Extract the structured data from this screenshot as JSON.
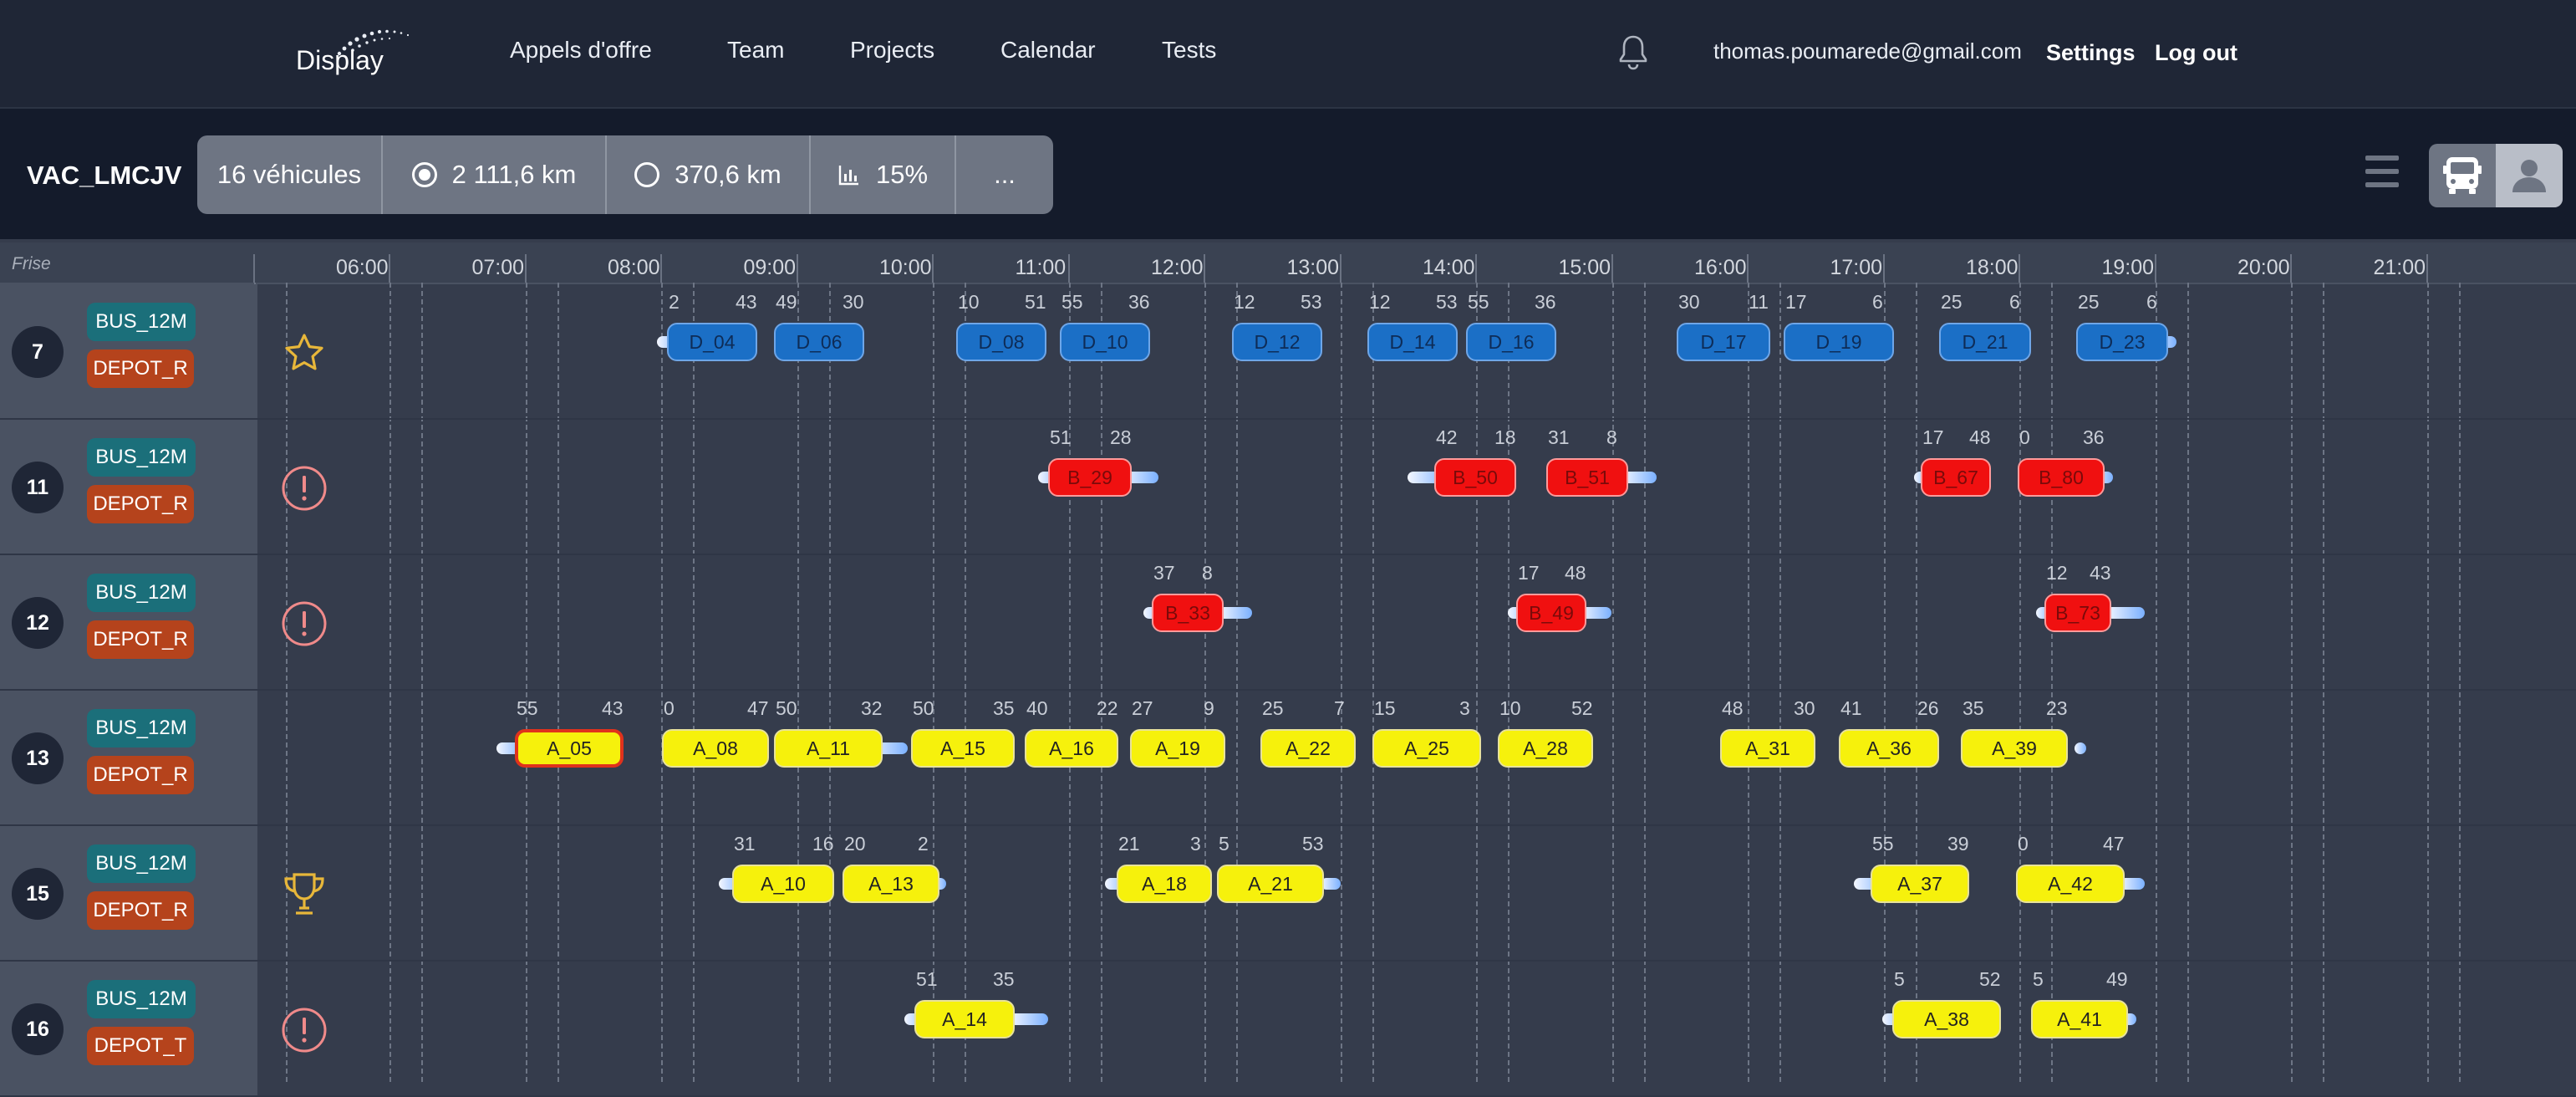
{
  "nav": {
    "logo": "Display",
    "links": [
      "Appels d'offre",
      "Team",
      "Projects",
      "Calendar",
      "Tests"
    ],
    "email": "thomas.poumarede@gmail.com",
    "settings": "Settings",
    "logout": "Log out"
  },
  "header": {
    "title": "VAC_LMCJV",
    "stats": {
      "vehicles": "16 véhicules",
      "km_loaded": "2 111,6 km",
      "km_empty": "370,6 km",
      "ratio": "15%",
      "more": "..."
    }
  },
  "frise": {
    "label": "Frise",
    "hours": [
      "06:00",
      "07:00",
      "08:00",
      "09:00",
      "10:00",
      "11:00",
      "12:00",
      "13:00",
      "14:00",
      "15:00",
      "16:00",
      "17:00",
      "18:00",
      "19:00",
      "20:00",
      "21:00"
    ]
  },
  "rows": [
    {
      "num": "7",
      "bus": "BUS_12M",
      "depot": "DEPOT_R",
      "status": "star-icon",
      "trips": [
        {
          "label": "D_04",
          "color": "blue",
          "start": "2",
          "end": "43"
        },
        {
          "label": "D_06",
          "color": "blue",
          "start": "49",
          "end": "30"
        },
        {
          "label": "D_08",
          "color": "blue",
          "start": "10",
          "end": "51"
        },
        {
          "label": "D_10",
          "color": "blue",
          "start": "55",
          "end": "36"
        },
        {
          "label": "D_12",
          "color": "blue",
          "start": "12",
          "end": "53"
        },
        {
          "label": "D_14",
          "color": "blue",
          "start": "12",
          "end": "53"
        },
        {
          "label": "D_16",
          "color": "blue",
          "start": "55",
          "end": "36"
        },
        {
          "label": "D_17",
          "color": "blue",
          "start": "30",
          "end": "11"
        },
        {
          "label": "D_19",
          "color": "blue",
          "start": "17",
          "end": "6"
        },
        {
          "label": "D_21",
          "color": "blue",
          "start": "25",
          "end": "6"
        },
        {
          "label": "D_23",
          "color": "blue",
          "start": "25",
          "end": "6"
        }
      ]
    },
    {
      "num": "11",
      "bus": "BUS_12M",
      "depot": "DEPOT_R",
      "status": "warning-icon",
      "trips": [
        {
          "label": "B_29",
          "color": "red",
          "start": "51",
          "end": "28"
        },
        {
          "label": "B_50",
          "color": "red",
          "start": "42",
          "end": "18"
        },
        {
          "label": "B_51",
          "color": "red",
          "start": "31",
          "end": "8"
        },
        {
          "label": "B_67",
          "color": "red",
          "start": "17",
          "end": "48"
        },
        {
          "label": "B_80",
          "color": "red",
          "start": "0",
          "end": "36"
        }
      ]
    },
    {
      "num": "12",
      "bus": "BUS_12M",
      "depot": "DEPOT_R",
      "status": "warning-icon",
      "trips": [
        {
          "label": "B_33",
          "color": "red",
          "start": "37",
          "end": "8"
        },
        {
          "label": "B_49",
          "color": "red",
          "start": "17",
          "end": "48"
        },
        {
          "label": "B_73",
          "color": "red",
          "start": "12",
          "end": "43"
        }
      ]
    },
    {
      "num": "13",
      "bus": "BUS_12M",
      "depot": "DEPOT_R",
      "status": "",
      "trips": [
        {
          "label": "A_05",
          "color": "yellow",
          "start": "55",
          "end": "43",
          "selected": true
        },
        {
          "label": "A_08",
          "color": "yellow",
          "start": "0",
          "end": "47"
        },
        {
          "label": "A_11",
          "color": "yellow",
          "start": "50",
          "end": "32"
        },
        {
          "label": "A_15",
          "color": "yellow",
          "start": "50",
          "end": "35"
        },
        {
          "label": "A_16",
          "color": "yellow",
          "start": "40",
          "end": "22"
        },
        {
          "label": "A_19",
          "color": "yellow",
          "start": "27",
          "end": "9"
        },
        {
          "label": "A_22",
          "color": "yellow",
          "start": "25",
          "end": "7"
        },
        {
          "label": "A_25",
          "color": "yellow",
          "start": "15",
          "end": "3"
        },
        {
          "label": "A_28",
          "color": "yellow",
          "start": "10",
          "end": "52"
        },
        {
          "label": "A_31",
          "color": "yellow",
          "start": "48",
          "end": "30"
        },
        {
          "label": "A_36",
          "color": "yellow",
          "start": "41",
          "end": "26"
        },
        {
          "label": "A_39",
          "color": "yellow",
          "start": "35",
          "end": "23"
        }
      ]
    },
    {
      "num": "15",
      "bus": "BUS_12M",
      "depot": "DEPOT_R",
      "status": "trophy-icon",
      "trips": [
        {
          "label": "A_10",
          "color": "yellow",
          "start": "31",
          "end": "16"
        },
        {
          "label": "A_13",
          "color": "yellow",
          "start": "20",
          "end": "2"
        },
        {
          "label": "A_18",
          "color": "yellow",
          "start": "21",
          "end": "3"
        },
        {
          "label": "A_21",
          "color": "yellow",
          "start": "5",
          "end": "53"
        },
        {
          "label": "A_37",
          "color": "yellow",
          "start": "55",
          "end": "39"
        },
        {
          "label": "A_42",
          "color": "yellow",
          "start": "0",
          "end": "47"
        }
      ]
    },
    {
      "num": "16",
      "bus": "BUS_12M",
      "depot": "DEPOT_T",
      "status": "warning-icon",
      "trips": [
        {
          "label": "A_14",
          "color": "yellow",
          "start": "51",
          "end": "35"
        },
        {
          "label": "A_38",
          "color": "yellow",
          "start": "5",
          "end": "52"
        },
        {
          "label": "A_41",
          "color": "yellow",
          "start": "5",
          "end": "49"
        }
      ]
    }
  ],
  "colors": {
    "blue": "#1b6fc6",
    "red": "#f01010",
    "yellow": "#f6f10c",
    "bus_badge": "#1b6f7a",
    "depot_badge": "#b5431c"
  }
}
